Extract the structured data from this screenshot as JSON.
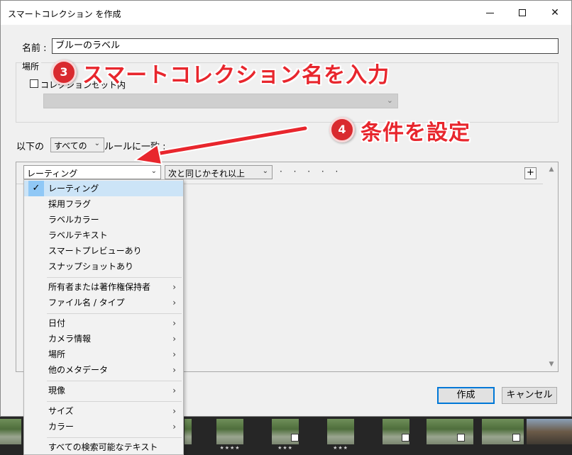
{
  "window": {
    "title": "スマートコレクション を作成",
    "minimize_label": "",
    "close_label": "✕"
  },
  "name_field": {
    "label": "名前 :",
    "value": "ブルーのラベル"
  },
  "location": {
    "label": "場所",
    "checkbox_label": "コレクションセット内",
    "checked": false
  },
  "match": {
    "prefix": "以下の",
    "selected": "すべての",
    "suffix": "ルールに一致 :"
  },
  "rule": {
    "criterion": "レーティング",
    "operator": "次と同じかそれ以上",
    "rating_dots": "· · · · ·",
    "add_label": "+"
  },
  "menu": {
    "items": [
      {
        "label": "レーティング",
        "checked": true,
        "submenu": false
      },
      {
        "label": "採用フラグ",
        "checked": false,
        "submenu": false
      },
      {
        "label": "ラベルカラー",
        "checked": false,
        "submenu": false
      },
      {
        "label": "ラベルテキスト",
        "checked": false,
        "submenu": false
      },
      {
        "label": "スマートプレビューあり",
        "checked": false,
        "submenu": false
      },
      {
        "label": "スナップショットあり",
        "checked": false,
        "submenu": false
      },
      {
        "label": "所有者または著作権保持者",
        "checked": false,
        "submenu": true
      },
      {
        "label": "ファイル名 / タイプ",
        "checked": false,
        "submenu": true
      },
      {
        "label": "日付",
        "checked": false,
        "submenu": true
      },
      {
        "label": "カメラ情報",
        "checked": false,
        "submenu": true
      },
      {
        "label": "場所",
        "checked": false,
        "submenu": true
      },
      {
        "label": "他のメタデータ",
        "checked": false,
        "submenu": true
      },
      {
        "label": "現像",
        "checked": false,
        "submenu": true
      },
      {
        "label": "サイズ",
        "checked": false,
        "submenu": true
      },
      {
        "label": "カラー",
        "checked": false,
        "submenu": true
      },
      {
        "label": "すべての検索可能なテキスト",
        "checked": false,
        "submenu": false
      }
    ]
  },
  "buttons": {
    "ok": "作成",
    "cancel": "キャンセル"
  },
  "annotations": {
    "step3_number": "3",
    "step3_text": "スマートコレクション名を入力",
    "step4_number": "4",
    "step4_text": "条件を設定",
    "color": "#e8262d"
  },
  "filmstrip": {
    "stars": [
      "★★★★",
      "★★★",
      "★★★"
    ]
  }
}
